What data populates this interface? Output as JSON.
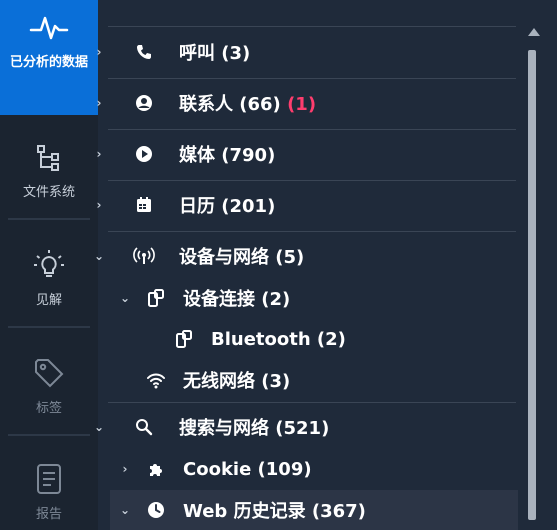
{
  "rail": {
    "items": [
      {
        "label": "已分析的数据",
        "icon": "pulse-icon",
        "active": true
      },
      {
        "label": "文件系统",
        "icon": "filesystem-icon"
      },
      {
        "label": "见解",
        "icon": "lightbulb-icon"
      },
      {
        "label": "标签",
        "icon": "tag-icon"
      },
      {
        "label": "报告",
        "icon": "report-icon"
      }
    ]
  },
  "tree": {
    "calls": {
      "label": "呼叫 (3)",
      "icon": "phone-icon"
    },
    "contacts": {
      "label": "联系人 (66)",
      "badge": "(1)",
      "icon": "contact-icon"
    },
    "media": {
      "label": "媒体 (790)",
      "icon": "play-icon"
    },
    "calendar": {
      "label": "日历 (201)",
      "icon": "calendar-icon"
    },
    "devices_networks": {
      "label": "设备与网络 (5)",
      "icon": "antenna-icon"
    },
    "device_connections": {
      "label": "设备连接 (2)",
      "icon": "device-link-icon"
    },
    "bluetooth": {
      "label": "Bluetooth (2)",
      "icon": "device-link-icon"
    },
    "wireless": {
      "label": "无线网络 (3)",
      "icon": "wifi-icon"
    },
    "search_web": {
      "label": "搜索与网络 (521)",
      "icon": "search-icon"
    },
    "cookie": {
      "label": "Cookie (109)",
      "icon": "puzzle-icon"
    },
    "web_history": {
      "label": "Web 历史记录 (367)",
      "icon": "clock-icon"
    }
  },
  "colors": {
    "accent": "#0a6fd8",
    "panel_bg": "#1f2a3a",
    "rail_bg": "#1b2430",
    "badge_red": "#ff3d6e"
  }
}
